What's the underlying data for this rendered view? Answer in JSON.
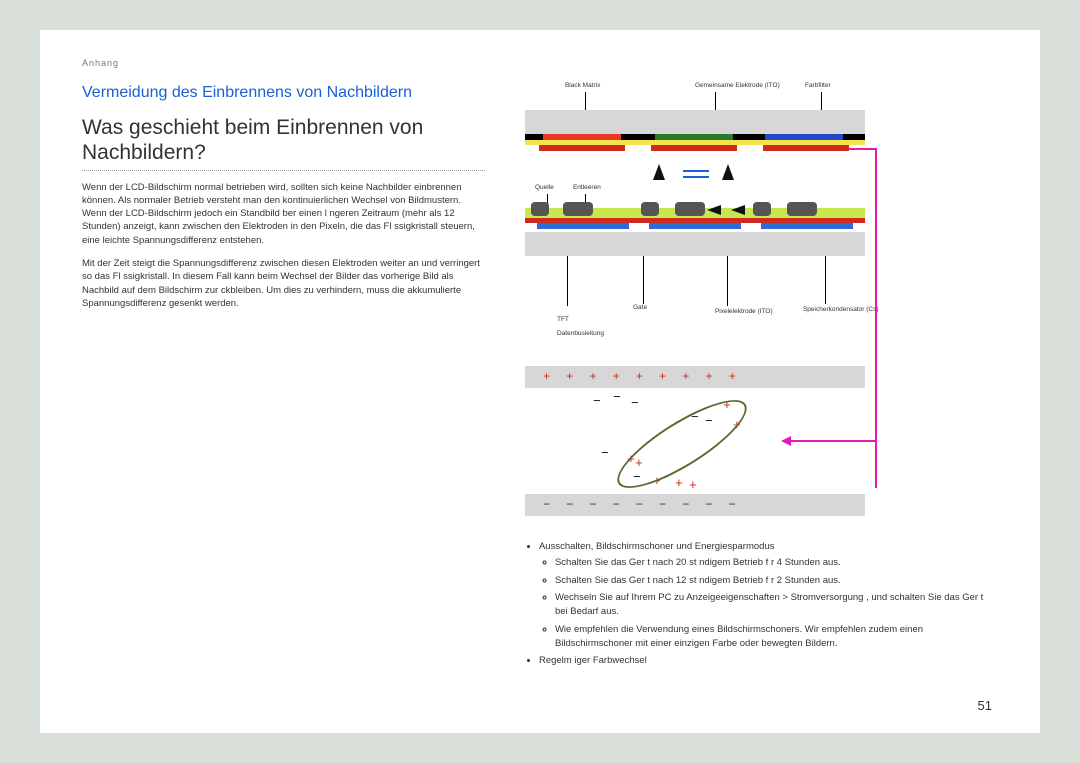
{
  "header_label": "Anhang",
  "section_title": "Vermeidung des Einbrennens von Nachbildern",
  "question_title": "Was geschieht beim Einbrennen von Nachbildern?",
  "para1": "Wenn der LCD-Bildschirm normal betrieben wird, sollten sich keine Nachbilder einbrennen können. Als normaler Betrieb versteht man den kontinuierlichen Wechsel von Bildmustern. Wenn der LCD-Bildschirm jedoch ein Standbild ber einen l ngeren Zeitraum (mehr als 12 Stunden) anzeigt, kann zwischen den Elektroden in den Pixeln, die das Fl ssigkristall steuern, eine leichte Spannungsdifferenz entstehen.",
  "para2": "Mit der Zeit steigt die Spannungsdifferenz zwischen diesen Elektroden weiter an und verringert so das Fl ssigkristall. In diesem Fall kann beim Wechsel der Bilder das vorherige Bild als Nachbild auf dem Bildschirm zur ckbleiben. Um dies zu verhindern, muss die akkumulierte Spannungsdifferenz gesenkt werden.",
  "diagram_labels": {
    "black_matrix": "Black Matrix",
    "common_electrode": "Gemeinsame Elektrode (ITO)",
    "color_filter": "Farbfilter",
    "source": "Quelle",
    "drain": "Entleeren",
    "gate": "Gate",
    "tft": "TFT",
    "data_bus": "Datenbusleitung",
    "pixel_electrode": "Pixelelektrode (ITO)",
    "storage_cap": "Speicherkondensator (Cs)"
  },
  "bullets": {
    "b1": "Ausschalten, Bildschirmschoner und Energiesparmodus",
    "b1a": "Schalten Sie das Ger t nach 20 st ndigem Betrieb f r 4 Stunden aus.",
    "b1b": "Schalten Sie das Ger t nach 12 st ndigem Betrieb f r 2 Stunden aus.",
    "b1c": "Wechseln Sie auf Ihrem PC zu  Anzeigeeigenschaften  >  Stromversorgung , und schalten Sie das Ger t bei Bedarf aus.",
    "b1d": "Wie empfehlen die Verwendung eines Bildschirmschoners. Wir empfehlen zudem einen Bildschirmschoner mit einer einzigen Farbe oder bewegten Bildern.",
    "b2": "Regelm  iger Farbwechsel"
  },
  "page_number": "51"
}
